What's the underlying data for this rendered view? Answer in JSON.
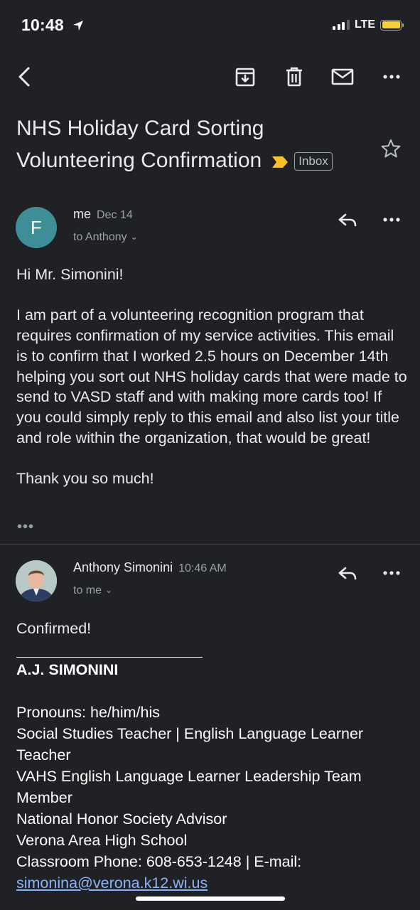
{
  "status_bar": {
    "time": "10:48",
    "network": "LTE",
    "battery_color": "#f4d03f"
  },
  "toolbar": {
    "back_icon": "back-arrow-icon",
    "archive_icon": "archive-icon",
    "delete_icon": "trash-icon",
    "mark_unread_icon": "mail-icon",
    "more_icon": "more-horizontal-icon"
  },
  "email": {
    "subject": "NHS Holiday Card Sorting Volunteering Confirmation",
    "label": "Inbox",
    "important_color": "#f6c026"
  },
  "messages": [
    {
      "avatar_letter": "F",
      "avatar_color": "#3e8e97",
      "sender": "me",
      "date": "Dec 14",
      "to": "to Anthony",
      "body": "Hi Mr. Simonini!\n\nI am part of a volunteering recognition program that requires confirmation of my service activities. This email is to confirm that I worked 2.5 hours on December 14th helping you sort out NHS holiday cards that were made to send to VASD staff and with making more cards too! If you could simply reply to this email and also list your title and role within the organization, that would be great!\n\nThank you so much!",
      "collapsed_quote": "•••"
    },
    {
      "sender": "Anthony Simonini",
      "date": "10:46 AM",
      "to": "to me",
      "body": "Confirmed!",
      "signature": {
        "name": "A.J. SIMONINI",
        "pronouns": "Pronouns: he/him/his",
        "line1": "Social Studies Teacher | English Language Learner Teacher",
        "line2": "VAHS English Language Learner Leadership Team Member",
        "line3": "National Honor Society Advisor",
        "line4": "Verona Area High School",
        "phone": "Classroom Phone: 608-653-1248 | E-mail:",
        "email": "simonina@verona.k12.wi.us"
      }
    }
  ]
}
